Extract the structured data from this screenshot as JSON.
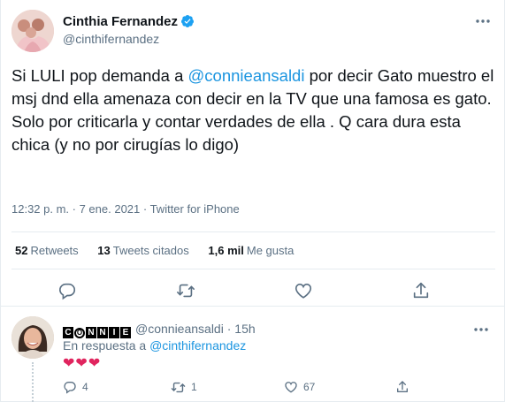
{
  "colors": {
    "link": "#1b95e0",
    "text": "#0f1419",
    "secondary": "#5b7083",
    "divider": "#e6ecf0",
    "verified": "#1da1f2",
    "heart": "#e0245e"
  },
  "tweet": {
    "author_name": "Cinthia Fernandez",
    "author_handle": "@cinthifernandez",
    "text_before_mention": "Si LULI pop demanda a ",
    "mention": "@connieansaldi",
    "text_after_mention": " por decir Gato muestro el msj dnd ella amenaza con decir en la TV que una famosa es gato. Solo por criticarla y contar verdades de ella . Q cara dura esta chica (y no por cirugías lo digo)",
    "meta": "12:32 p. m. · 7 ene. 2021 · Twitter for iPhone",
    "stats": {
      "retweets_count": "52",
      "retweets_label": "Retweets",
      "quotes_count": "13",
      "quotes_label": "Tweets citados",
      "likes_count": "1,6 mil",
      "likes_label": "Me gusta"
    },
    "icons": [
      "reply-icon",
      "retweet-icon",
      "like-icon",
      "share-icon",
      "more-icon",
      "verified-icon"
    ]
  },
  "reply": {
    "logo_text": "CONNIE",
    "author_handle": "@connieansaldi",
    "time": "· 15h",
    "reply_to_prefix": "En respuesta a",
    "reply_to_handle": "@cinthifernandez",
    "content": "❤❤❤",
    "reply_count": "4",
    "retweet_count": "1",
    "like_count": "67"
  }
}
